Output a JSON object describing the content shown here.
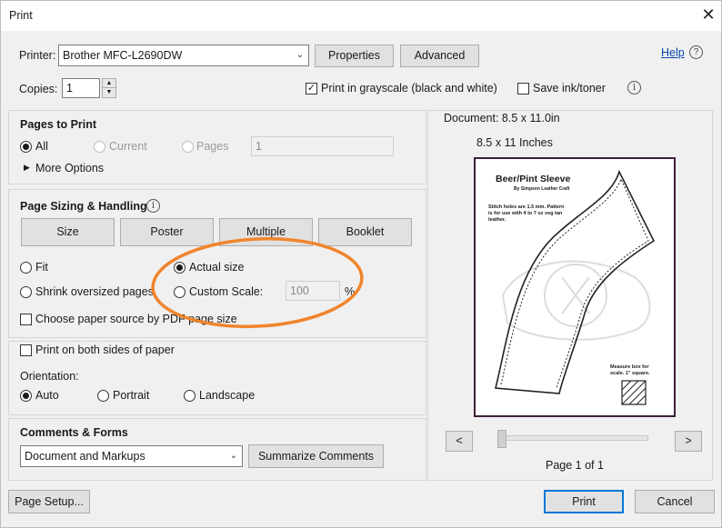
{
  "window": {
    "title": "Print",
    "close_glyph": "✕"
  },
  "printer": {
    "label": "Printer:",
    "value": "Brother MFC-L2690DW",
    "properties_label": "Properties",
    "advanced_label": "Advanced",
    "help_label": "Help",
    "help_icon": "?"
  },
  "copies": {
    "label": "Copies:",
    "value": "1",
    "grayscale_label": "Print in grayscale (black and white)",
    "grayscale_checked": true,
    "save_ink_label": "Save ink/toner",
    "save_ink_checked": false,
    "info_icon": "i"
  },
  "pages_to_print": {
    "header": "Pages to Print",
    "all_label": "All",
    "current_label": "Current",
    "pages_label": "Pages",
    "pages_value": "1",
    "more_options_label": "More Options"
  },
  "sizing": {
    "header": "Page Sizing & Handling",
    "info_icon": "i",
    "tabs": [
      "Size",
      "Poster",
      "Multiple",
      "Booklet"
    ],
    "fit_label": "Fit",
    "actual_label": "Actual size",
    "shrink_label": "Shrink oversized pages",
    "custom_label": "Custom Scale:",
    "custom_value": "100",
    "percent": "%",
    "paper_source_label": "Choose paper source by PDF page size",
    "annotation_color": "#f0852d"
  },
  "duplex": {
    "both_sides_label": "Print on both sides of paper",
    "orientation_label": "Orientation:",
    "auto_label": "Auto",
    "portrait_label": "Portrait",
    "landscape_label": "Landscape"
  },
  "comments": {
    "header": "Comments & Forms",
    "value": "Document and Markups",
    "summarize_label": "Summarize Comments"
  },
  "preview": {
    "document_label": "Document: 8.5 x 11.0in",
    "size_label": "8.5 x 11 Inches",
    "page_title": "Beer/Pint Sleeve",
    "page_subtitle": "By Simpson Leather Craft",
    "page_note": "Stitch holes are 1.5 mm. Pattern is for use with 4 to 7 oz veg tan leather.",
    "measure_note": "Measure box for scale. 1\" square.",
    "prev_glyph": "<",
    "next_glyph": ">",
    "page_counter": "Page 1 of 1"
  },
  "footer": {
    "page_setup_label": "Page Setup...",
    "print_label": "Print",
    "cancel_label": "Cancel"
  }
}
